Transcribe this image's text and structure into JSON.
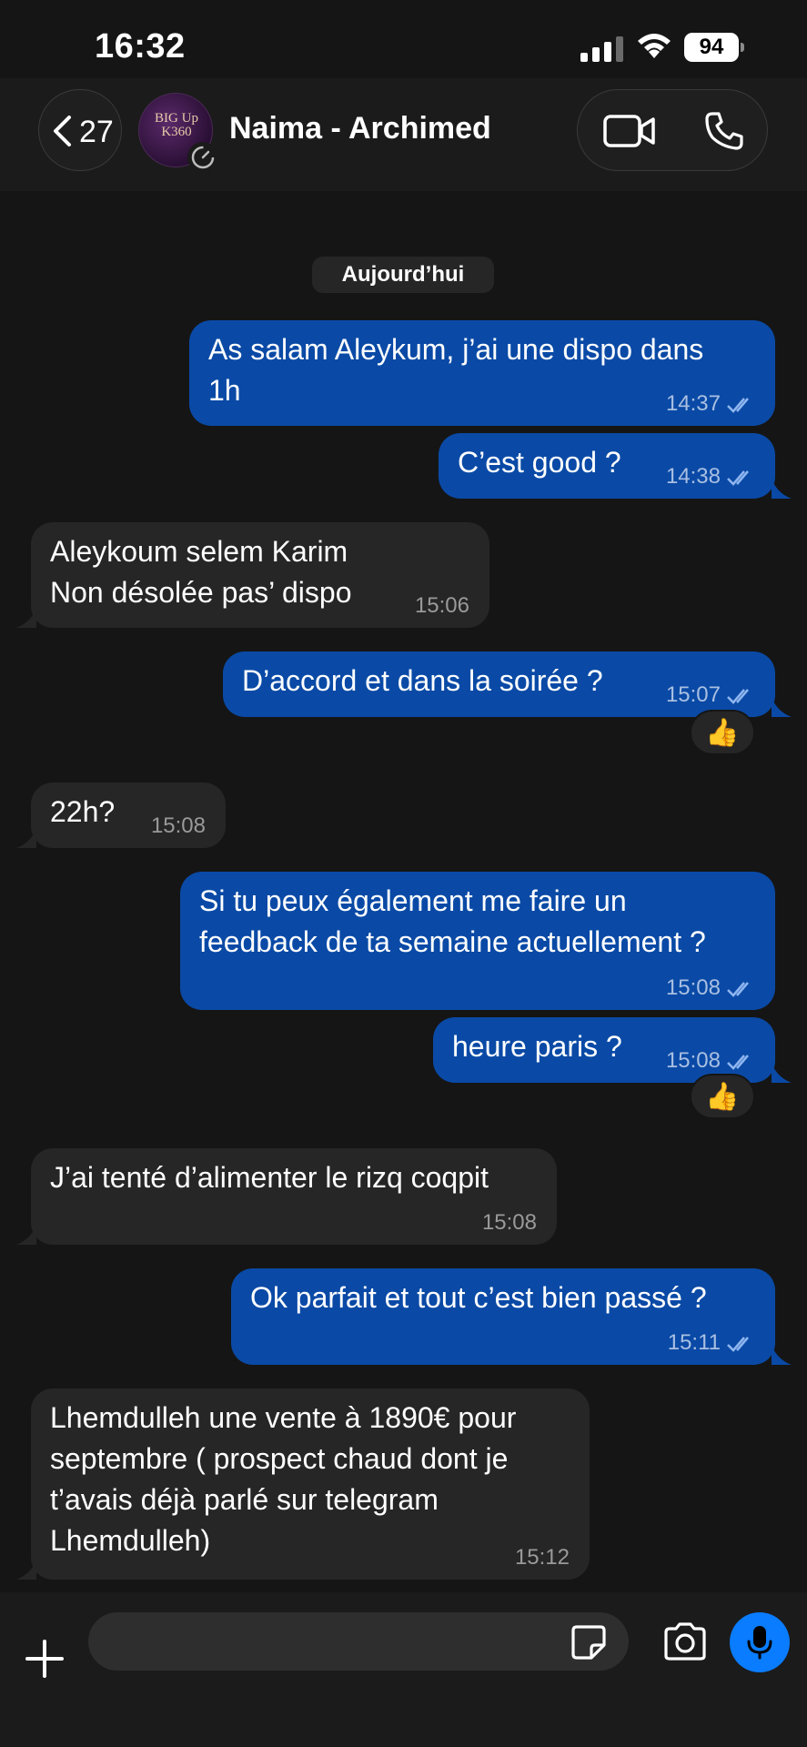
{
  "status_bar": {
    "time": "16:32",
    "battery": "94"
  },
  "header": {
    "back_count": "27",
    "avatar_text": "BIG Up K360",
    "contact_name": "Naima - Archimed"
  },
  "chat": {
    "date_label": "Aujourd’hui",
    "messages": [
      {
        "direction": "out",
        "text": "As salam Aleykum, j’ai une dispo dans\n1h",
        "time": "14:37",
        "read": true
      },
      {
        "direction": "out",
        "text": "C’est good ?",
        "time": "14:38",
        "read": true
      },
      {
        "direction": "in",
        "text": "Aleykoum selem Karim\nNon désolée pas’ dispo",
        "time": "15:06"
      },
      {
        "direction": "out",
        "text": "D’accord et dans la soirée ?",
        "time": "15:07",
        "read": true,
        "reaction": "👍"
      },
      {
        "direction": "in",
        "text": "22h?",
        "time": "15:08"
      },
      {
        "direction": "out",
        "text": "Si tu peux également me faire un\nfeedback de ta semaine actuellement ?",
        "time": "15:08",
        "read": true
      },
      {
        "direction": "out",
        "text": "heure paris ?",
        "time": "15:08",
        "read": true,
        "reaction": "👍"
      },
      {
        "direction": "in",
        "text": "J’ai tenté d’alimenter le rizq coqpit",
        "time": "15:08"
      },
      {
        "direction": "out",
        "text": "Ok parfait et tout c’est bien passé ?",
        "time": "15:11",
        "read": true
      },
      {
        "direction": "in",
        "text": "Lhemdulleh une vente à 1890€ pour\nseptembre ( prospect chaud dont je\nt’avais déjà parlé sur telegram\nLhemdulleh)",
        "time": "15:12"
      }
    ]
  },
  "input_bar": {
    "message_value": "",
    "placeholder": ""
  },
  "colors": {
    "outgoing_bubble": "#0a4aa6",
    "incoming_bubble": "#262626",
    "background": "#151515",
    "accent": "#0a7cff"
  },
  "icons": [
    "chevron-left-icon",
    "video-camera-icon",
    "phone-icon",
    "plus-icon",
    "sticker-icon",
    "camera-icon",
    "microphone-icon",
    "double-check-icon",
    "thumbs-up-reaction"
  ]
}
